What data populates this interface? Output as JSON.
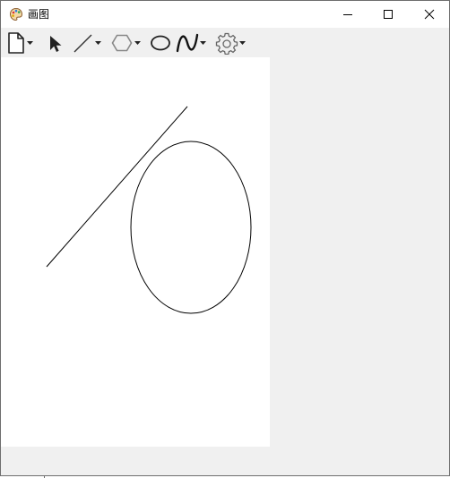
{
  "window": {
    "title": "画图",
    "icon": "palette-icon",
    "controls": [
      "minimize-icon",
      "maximize-icon",
      "close-icon"
    ]
  },
  "toolbar": {
    "tools": [
      {
        "name": "new-file",
        "icon": "document-icon",
        "has_dropdown": true
      },
      {
        "name": "select",
        "icon": "arrow-pointer-icon",
        "has_dropdown": false
      },
      {
        "name": "line",
        "icon": "line-icon",
        "has_dropdown": true
      },
      {
        "name": "polygon",
        "icon": "hexagon-icon",
        "has_dropdown": true
      },
      {
        "name": "ellipse",
        "icon": "ellipse-icon",
        "has_dropdown": false
      },
      {
        "name": "curve",
        "icon": "curve-icon",
        "has_dropdown": true
      },
      {
        "name": "settings",
        "icon": "gear-icon",
        "has_dropdown": true
      }
    ]
  },
  "canvas": {
    "background": "#ffffff",
    "shapes": [
      "line",
      "ellipse"
    ],
    "stroke_color": "#000000"
  },
  "colors": {
    "window_bg": "#f0f0f0",
    "titlebar_bg": "#ffffff",
    "border": "#6e6e6e"
  }
}
